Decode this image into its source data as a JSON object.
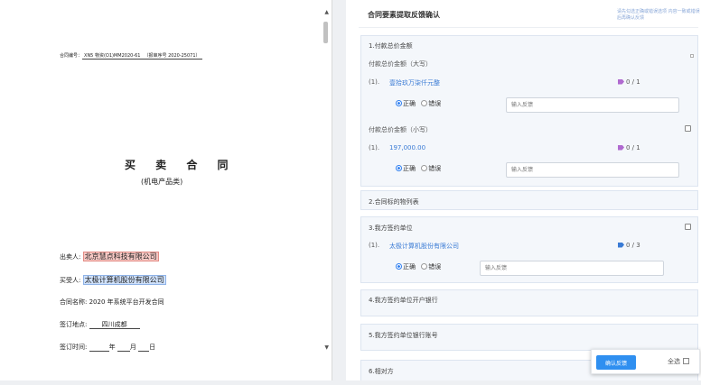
{
  "document": {
    "contract_no_label": "合同编号：",
    "contract_no_value": "XN5 物资(O1)MM2020-61",
    "contract_no_suffix": "（报审序号 2020-25071）",
    "title": "买 卖 合 同",
    "subtitle": "(机电产品类)",
    "seller_label": "出卖人:",
    "seller_value": "北京慧点科技有限公司",
    "buyer_label": "买受人:",
    "buyer_value": "太极计算机股份有限公司",
    "name_label": "合同名称:",
    "name_value": "2020 年系统平台开发合同",
    "place_label": "签订地点:",
    "place_value": "四川成都",
    "time_label": "签订时间:",
    "year_char": "年",
    "month_char": "月",
    "day_char": "日"
  },
  "panel": {
    "title": "合同要素提取反馈确认",
    "hint": "请先勾选正确或错误选项 内容一致或错误后再确认反馈"
  },
  "sections": {
    "total": {
      "head": "1.付款总价金额",
      "upper": {
        "label": "付款总价金额（大写）",
        "index": "(1).",
        "value": "壹拾玖万柒仟元整",
        "tag": "0 / 1",
        "correct": "正确",
        "wrong": "错误",
        "placeholder": "输入反馈"
      },
      "lower": {
        "label": "付款总价金额（小写）",
        "index": "(1).",
        "value": "197,000.00",
        "tag": "0 / 1",
        "correct": "正确",
        "wrong": "错误",
        "placeholder": "输入反馈"
      }
    },
    "goods": {
      "head": "2.合同标的物列表"
    },
    "party": {
      "head": "3.我方签约单位",
      "index": "(1).",
      "value": "太极计算机股份有限公司",
      "tag": "0 / 3",
      "correct": "正确",
      "wrong": "错误",
      "placeholder": "输入反馈"
    },
    "bank_name": {
      "head": "4.我方签约单位开户银行"
    },
    "bank_account": {
      "head": "5.我方签约单位银行账号"
    },
    "counterparty": {
      "head": "6.相对方"
    }
  },
  "actions": {
    "confirm": "确认反馈",
    "select_all": "全选"
  },
  "colors": {
    "accent": "#2f8ff0",
    "tag_purple": "#b06ad0",
    "tag_blue": "#3a7bd5"
  },
  "icons": {
    "tag": "tag-icon",
    "checkbox": "checkbox-icon",
    "scroll_up": "arrow-up-icon",
    "scroll_down": "arrow-down-icon"
  }
}
